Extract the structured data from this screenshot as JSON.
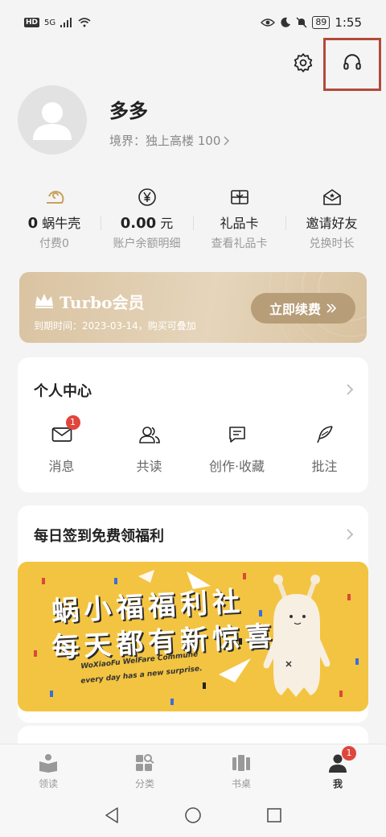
{
  "status_bar": {
    "hd": "HD",
    "network": "5G",
    "battery": "89",
    "time": "1:55"
  },
  "profile": {
    "username": "多多",
    "realm_label": "境界：独上高楼 100"
  },
  "stats": [
    {
      "value": "0",
      "unit": "蜗牛壳",
      "sub": "付费0",
      "icon": "snail-shell-icon"
    },
    {
      "value": "0.00",
      "unit": "元",
      "sub": "账户余额明细",
      "icon": "yen-icon"
    },
    {
      "value": "",
      "unit": "礼品卡",
      "sub": "查看礼品卡",
      "icon": "gift-card-icon"
    },
    {
      "value": "",
      "unit": "邀请好友",
      "sub": "兑换时长",
      "icon": "invite-mail-icon"
    }
  ],
  "turbo": {
    "title": "Turbo会员",
    "expiry": "到期时间：2023-03-14，购买可叠加",
    "renew_label": "立即续费"
  },
  "personal_center": {
    "title": "个人中心",
    "items": [
      {
        "label": "消息",
        "icon": "mail-icon",
        "badge": "1"
      },
      {
        "label": "共读",
        "icon": "people-icon",
        "badge": ""
      },
      {
        "label": "创作·收藏",
        "icon": "comment-edit-icon",
        "badge": ""
      },
      {
        "label": "批注",
        "icon": "feather-icon",
        "badge": ""
      }
    ]
  },
  "signin": {
    "title": "每日签到免费领福利",
    "banner_line1": "蜗小福福利社",
    "banner_line2": "每天都有新惊喜",
    "banner_en1": "WoXiaoFu WelFare Commune",
    "banner_en2": "every day has a new surprise."
  },
  "bottom_nav": [
    {
      "label": "领读",
      "icon": "reading-icon",
      "active": false,
      "badge": ""
    },
    {
      "label": "分类",
      "icon": "category-icon",
      "active": false,
      "badge": ""
    },
    {
      "label": "书桌",
      "icon": "bookshelf-icon",
      "active": false,
      "badge": ""
    },
    {
      "label": "我",
      "icon": "profile-icon",
      "active": true,
      "badge": "1"
    }
  ],
  "colors": {
    "accent_gold": "#b79d78",
    "badge_red": "#e0453c",
    "highlight_box": "#b24a3a",
    "banner_yellow": "#f3c441"
  }
}
